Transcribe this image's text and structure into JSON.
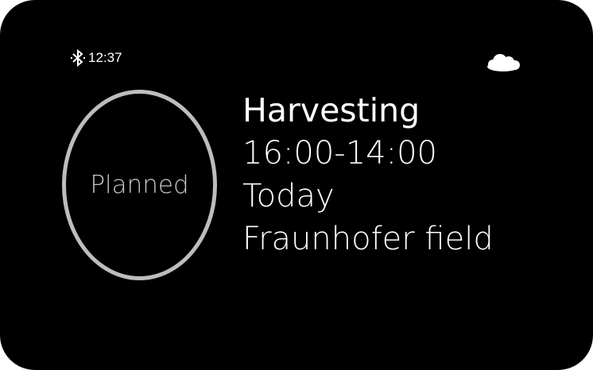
{
  "status_bar": {
    "bluetooth_icon": "bluetooth-icon",
    "time": "12:37",
    "weather_icon": "cloud-icon"
  },
  "task": {
    "status": "Planned",
    "title": "Harvesting",
    "time_range": "16:00-14:00",
    "day": "Today",
    "location": "Fraunhofer field"
  },
  "colors": {
    "background": "#000000",
    "text": "#ffffff",
    "ring": "#bdbdbd",
    "status_text": "#c8c8c8"
  }
}
